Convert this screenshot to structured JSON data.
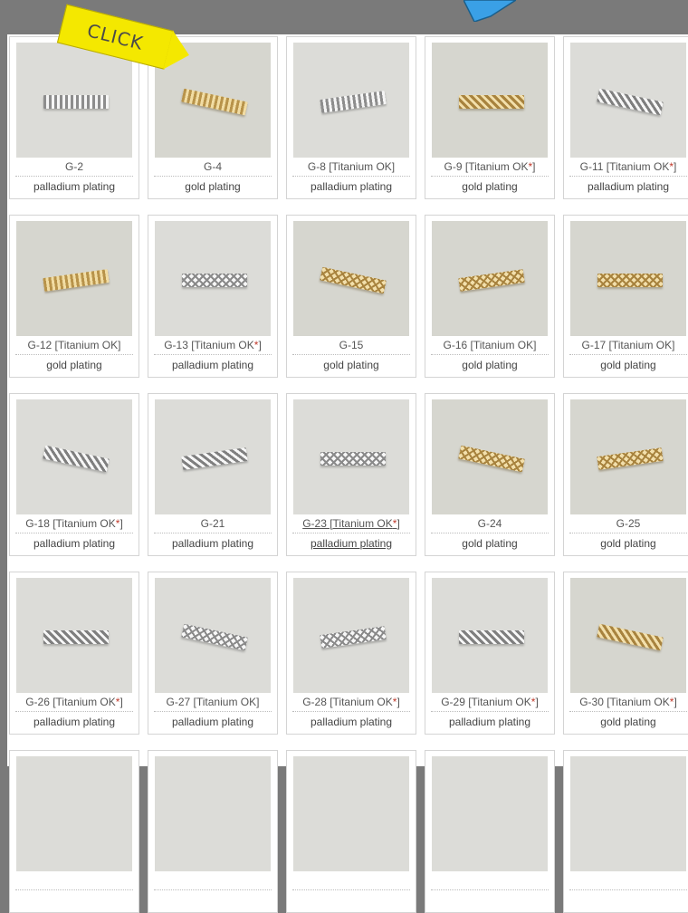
{
  "overlay": {
    "click_label": "CLICK",
    "click_color": "#f4e800",
    "blue_arrow_color": "#3aa0e6"
  },
  "products": [
    {
      "code": "G-2",
      "plating": "palladium plating",
      "titanium_star": false,
      "finish": "pal",
      "pattern": "stripes"
    },
    {
      "code": "G-4",
      "plating": "gold plating",
      "titanium_star": false,
      "finish": "gold",
      "pattern": "stripes"
    },
    {
      "code": "G-8 [Titanium OK]",
      "plating": "palladium plating",
      "titanium_star": false,
      "finish": "pal",
      "pattern": "stripes"
    },
    {
      "code": "G-9 [Titanium OK*]",
      "plating": "gold plating",
      "titanium_star": true,
      "finish": "gold",
      "pattern": "diag"
    },
    {
      "code": "G-11 [Titanium OK*]",
      "plating": "palladium plating",
      "titanium_star": true,
      "finish": "pal",
      "pattern": "diag"
    },
    {
      "code": "G-12 [Titanium OK]",
      "plating": "gold plating",
      "titanium_star": false,
      "finish": "gold",
      "pattern": "stripes"
    },
    {
      "code": "G-13 [Titanium OK*]",
      "plating": "palladium plating",
      "titanium_star": true,
      "finish": "pal",
      "pattern": "cross"
    },
    {
      "code": "G-15",
      "plating": "gold plating",
      "titanium_star": false,
      "finish": "gold",
      "pattern": "cross"
    },
    {
      "code": "G-16 [Titanium OK]",
      "plating": "gold plating",
      "titanium_star": false,
      "finish": "gold",
      "pattern": "cross"
    },
    {
      "code": "G-17 [Titanium OK]",
      "plating": "gold plating",
      "titanium_star": false,
      "finish": "gold",
      "pattern": "cross"
    },
    {
      "code": "G-18 [Titanium OK*]",
      "plating": "palladium plating",
      "titanium_star": true,
      "finish": "pal",
      "pattern": "diag"
    },
    {
      "code": "G-21",
      "plating": "palladium plating",
      "titanium_star": false,
      "finish": "pal",
      "pattern": "diag"
    },
    {
      "code": "G-23 [Titanium OK*]",
      "plating": "palladium plating",
      "titanium_star": true,
      "finish": "pal",
      "pattern": "cross",
      "hover": true
    },
    {
      "code": "G-24",
      "plating": "gold plating",
      "titanium_star": false,
      "finish": "gold",
      "pattern": "cross"
    },
    {
      "code": "G-25",
      "plating": "gold plating",
      "titanium_star": false,
      "finish": "gold",
      "pattern": "cross"
    },
    {
      "code": "G-26 [Titanium OK*]",
      "plating": "palladium plating",
      "titanium_star": true,
      "finish": "pal",
      "pattern": "diag"
    },
    {
      "code": "G-27 [Titanium OK]",
      "plating": "palladium plating",
      "titanium_star": false,
      "finish": "pal",
      "pattern": "cross"
    },
    {
      "code": "G-28 [Titanium OK*]",
      "plating": "palladium plating",
      "titanium_star": true,
      "finish": "pal",
      "pattern": "cross"
    },
    {
      "code": "G-29 [Titanium OK*]",
      "plating": "palladium plating",
      "titanium_star": true,
      "finish": "pal",
      "pattern": "diag"
    },
    {
      "code": "G-30 [Titanium OK*]",
      "plating": "gold plating",
      "titanium_star": true,
      "finish": "gold",
      "pattern": "diag"
    },
    {
      "code": "",
      "plating": "",
      "titanium_star": false,
      "finish": "pal",
      "pattern": "none"
    },
    {
      "code": "",
      "plating": "",
      "titanium_star": false,
      "finish": "pal",
      "pattern": "none"
    },
    {
      "code": "",
      "plating": "",
      "titanium_star": false,
      "finish": "pal",
      "pattern": "none"
    },
    {
      "code": "",
      "plating": "",
      "titanium_star": false,
      "finish": "pal",
      "pattern": "none"
    },
    {
      "code": "",
      "plating": "",
      "titanium_star": false,
      "finish": "pal",
      "pattern": "none"
    }
  ]
}
